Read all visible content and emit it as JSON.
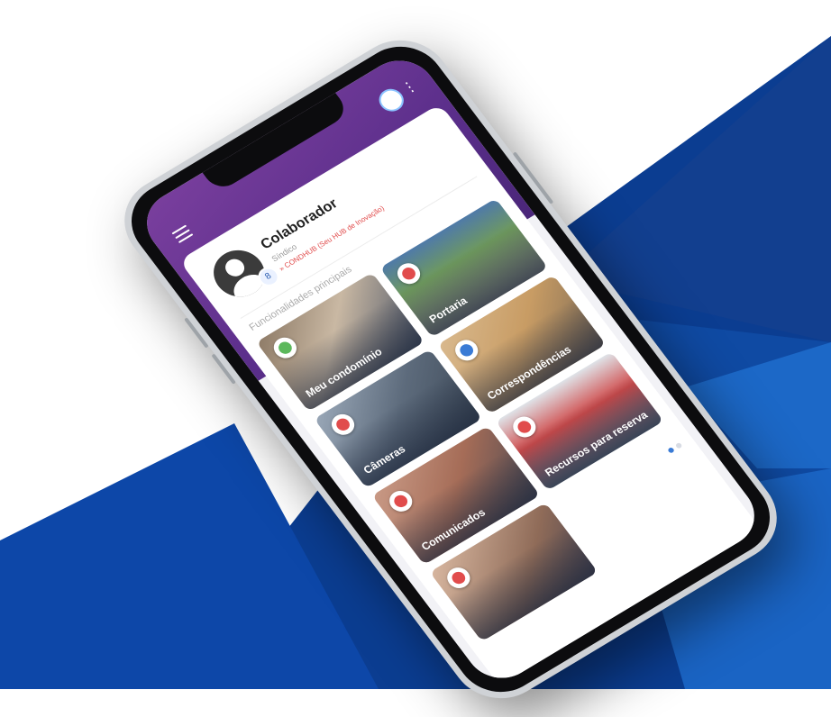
{
  "colors": {
    "header_purple": "#6a3894",
    "background_blue": "#0b3d91",
    "accent_red": "#e14c4c",
    "page_dot_active": "#3a7bd5"
  },
  "header": {
    "menu_icon": "hamburger-menu-icon",
    "brand_icon": "condominium-logo-icon",
    "overflow_icon": "more-vertical-icon"
  },
  "profile": {
    "name": "Colaborador",
    "role": "Síndico",
    "organization": "» CONDHUB (Seu HUB de Inovação)",
    "badge": "8"
  },
  "section_title": "Funcionalidades principais",
  "tiles": [
    {
      "label": "Meu condomínio",
      "icon": "building-icon",
      "icon_color": "#5cb85c"
    },
    {
      "label": "Portaria",
      "icon": "bell-icon",
      "icon_color": "#e14c4c"
    },
    {
      "label": "Câmeras",
      "icon": "camera-icon",
      "icon_color": "#e14c4c"
    },
    {
      "label": "Correspondências",
      "icon": "mailbox-icon",
      "icon_color": "#3a7bd5"
    },
    {
      "label": "Comunicados",
      "icon": "announcement-icon",
      "icon_color": "#e14c4c"
    },
    {
      "label": "Recursos para reserva",
      "icon": "calendar-icon",
      "icon_color": "#e14c4c"
    },
    {
      "label": "",
      "icon": "people-icon",
      "icon_color": "#e14c4c"
    }
  ],
  "pager": {
    "pages": 2,
    "active": 1
  }
}
